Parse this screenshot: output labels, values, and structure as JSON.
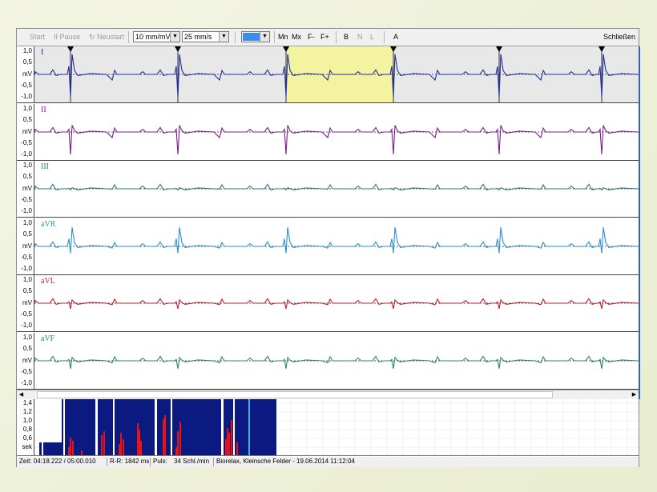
{
  "toolbar": {
    "start": "Start",
    "pause": "II Pause",
    "restart": "↻ Neustart",
    "gain": "10 mm/mV",
    "speed": "25 mm/s",
    "mn": "Mn",
    "mx": "Mx",
    "f_minus": "F-",
    "f_plus": "F+",
    "b": "B",
    "n": "N",
    "l": "L",
    "a": "A",
    "close": "Schließen"
  },
  "y_ticks": [
    "1,0",
    "0,5",
    "mV",
    "-0,5",
    "-1,0"
  ],
  "leads": [
    {
      "name": "I",
      "color": "#1f2fa0",
      "peak": 0.9,
      "trough": -1.0
    },
    {
      "name": "II",
      "color": "#7a1f8c",
      "peak": 0.3,
      "trough": -1.0
    },
    {
      "name": "III",
      "color": "#2a7a7a",
      "peak": 0.05,
      "trough": -0.05
    },
    {
      "name": "aVR",
      "color": "#2a8ecf",
      "peak": 0.85,
      "trough": -0.3
    },
    {
      "name": "aVL",
      "color": "#c0202a",
      "peak": 0.15,
      "trough": -0.25
    },
    {
      "name": "aVF",
      "color": "#2a8a5a",
      "peak": 0.15,
      "trough": -0.35
    }
  ],
  "highlight_color": "#f3f3a0",
  "beat_markers_count": 6,
  "rr_chart": {
    "y_ticks": [
      "1,4",
      "1,2",
      "1,0",
      "0,8",
      "0,6",
      "sek"
    ],
    "bar_color": "#0a1a80",
    "spike_color": "#ee1111",
    "cursor_color": "#4ab0d8"
  },
  "status": {
    "time": "Zeit: 04:18.222 / 05:00.010",
    "rr": "R-R: 1842 ms",
    "pulse_label": "Puls:",
    "pulse_value": "34 Schl./min",
    "session": "Biorelax, Kleinsche Felder - 19.06.2014 11:12:04"
  }
}
